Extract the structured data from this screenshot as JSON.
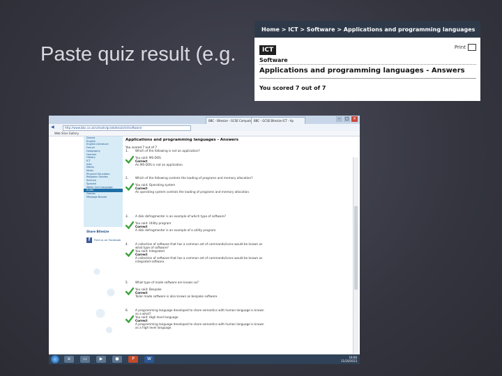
{
  "slide": {
    "title": "Paste quiz result (e.g."
  },
  "crop": {
    "breadcrumb": "Home > ICT > Software > Applications and programming languages",
    "badge": "ICT",
    "print_label": "Print",
    "section": "Software",
    "heading": "Applications and programming languages - Answers",
    "score": "You scored 7 out of 7"
  },
  "browser": {
    "tabs": [
      "BBC - Bitesize - GCSE Computer",
      "BBC - GCSE Bitesize ICT - Ap"
    ],
    "address": "http://www.bbc.co.uk/schools/gcsebitesize/ict/software/",
    "favorites": "Web Slice Gallery"
  },
  "sidebar": {
    "items": [
      "Drama",
      "English",
      "English Literature",
      "French",
      "Geography",
      "German",
      "History",
      "ICT",
      "Irish",
      "Maths",
      "Music",
      "Physical Education",
      "Religious Studies",
      "Science",
      "Spanish",
      "Welsh 2nd Language",
      "Audio",
      "Games",
      "Message Boards"
    ],
    "active_index": 16,
    "share_heading": "Share Bitesize",
    "facebook_label": "Find us on Facebook"
  },
  "content": {
    "title": "Applications and programming languages - Answers",
    "scored": "You scored 7 out of 7",
    "questions": [
      {
        "num": "1.",
        "text": "Which of the following is not an application?",
        "answer": "You said: MS-DOS",
        "correct": "Correct",
        "explain": "An MS-DOS is not an application."
      },
      {
        "num": "2.",
        "text": "Which of the following controls the loading of programs and memory allocation?",
        "answer": "You said: Operating system",
        "correct": "Correct",
        "explain": "An operating system controls the loading of programs and memory allocation."
      },
      {
        "num": "3.",
        "text": "A disk defragmenter is an example of which type of software?",
        "answer": "You said: Utility program",
        "correct": "Correct",
        "explain": "A disk defragmenter is an example of a utility program."
      },
      {
        "num": "4.",
        "text": "A collection of software that has a common set of commands/icons would be known as what type of software?",
        "answer": "You said: Integrated",
        "correct": "Correct",
        "explain": "A collection of software that has a common set of commands/icons would be known as integrated software."
      },
      {
        "num": "5.",
        "text": "What type of made software are known as?",
        "answer": "You said: Bespoke",
        "correct": "Correct",
        "explain": "Tailor made software is also known as bespoke software."
      },
      {
        "num": "6.",
        "text": "A programming language developed to share semantics with human language is known as a what?",
        "answer": "You said: High level language",
        "correct": "Correct",
        "explain": "A programming language developed to share semantics with human language is known as a high level language."
      }
    ]
  },
  "taskbar": {
    "time": "19:00",
    "date": "11/10/2013",
    "icons": [
      "ie-icon",
      "folder-icon",
      "media-icon",
      "firefox-icon",
      "powerpoint-icon",
      "word-icon"
    ]
  }
}
